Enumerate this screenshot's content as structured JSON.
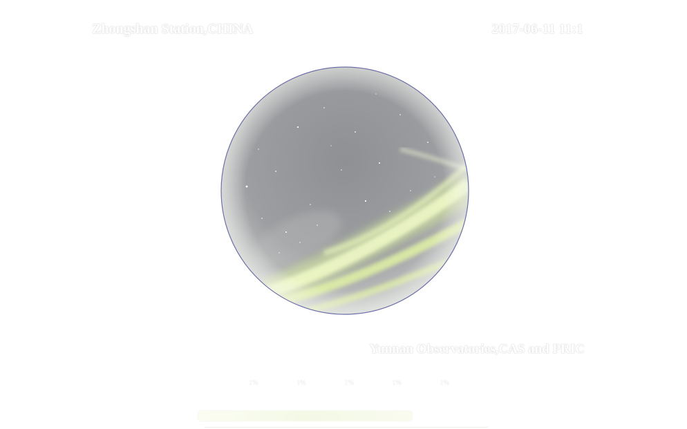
{
  "header": {
    "station": "Zhongshan Station,CHINA",
    "timestamp": "2017-06-11 11:1"
  },
  "footer": {
    "credit": "Yunnan Observatories,CAS and PRIC"
  },
  "scale": {
    "ticks": [
      "1%",
      "1%",
      "1%",
      "1%",
      "1%"
    ]
  },
  "colors": {
    "sky": "#8a8c90",
    "aurora": "#e2f3a0",
    "rim": "#6c6fa8"
  }
}
